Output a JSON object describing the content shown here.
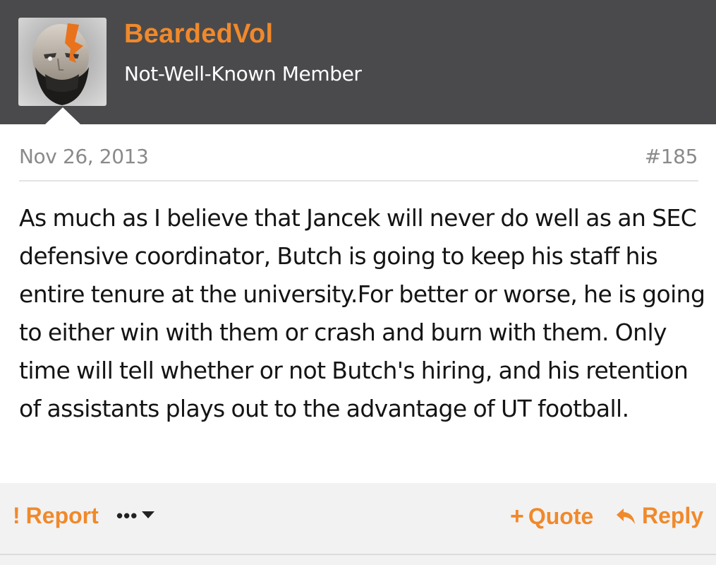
{
  "post": {
    "username": "BeardedVol",
    "user_title": "Not-Well-Known Member",
    "date": "Nov 26, 2013",
    "number": "#185",
    "body": "As much as I believe that Jancek will never do well as an SEC defensive coordinator, Butch is going to keep his staff his entire tenure at the university.For better or worse, he is going to either win with them or crash and burn with them. Only time will tell whether or not Butch's hiring, and his retention of assistants plays out to the advantage of UT football."
  },
  "actions": {
    "report_icon": "!",
    "report": "Report",
    "more": "•••",
    "quote_icon": "+",
    "quote": "Quote",
    "reply": "Reply"
  },
  "colors": {
    "header_bg": "#4a4a4c",
    "accent": "#f0892b",
    "footer_bg": "#f2f2f2"
  }
}
